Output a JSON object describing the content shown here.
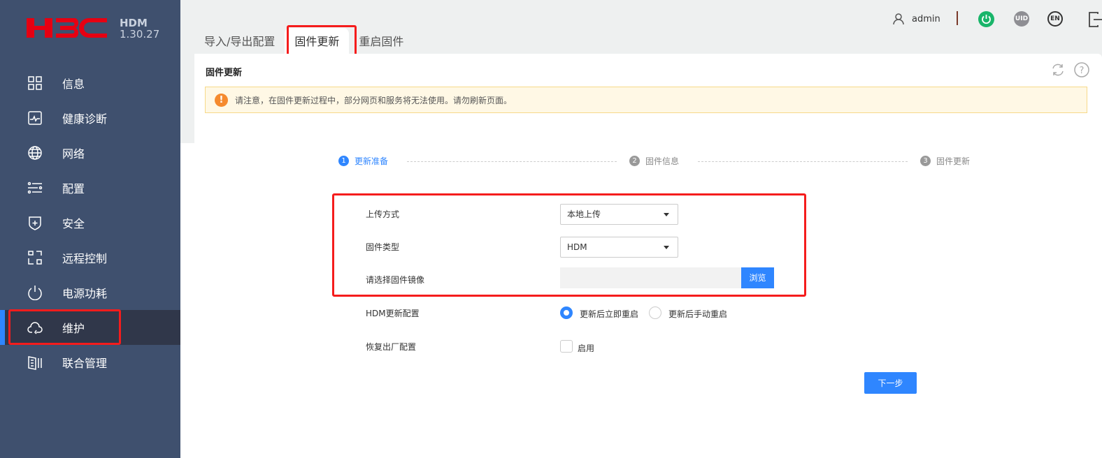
{
  "brand": {
    "logo_text": "H3C",
    "product": "HDM",
    "version": "1.30.27"
  },
  "sidebar": {
    "items": [
      {
        "label": "信息",
        "icon": "grid-icon"
      },
      {
        "label": "健康诊断",
        "icon": "health-monitor-icon"
      },
      {
        "label": "网络",
        "icon": "globe-icon"
      },
      {
        "label": "配置",
        "icon": "sliders-icon"
      },
      {
        "label": "安全",
        "icon": "shield-icon"
      },
      {
        "label": "远程控制",
        "icon": "remote-control-icon"
      },
      {
        "label": "电源功耗",
        "icon": "power-icon"
      },
      {
        "label": "维护",
        "icon": "cloud-icon",
        "active": true
      },
      {
        "label": "联合管理",
        "icon": "server-rack-icon"
      }
    ]
  },
  "header": {
    "user": "admin",
    "power_color": "#19b56a",
    "uid_label": "UID",
    "lang_label": "EN"
  },
  "tabs": [
    {
      "label": "导入/导出配置"
    },
    {
      "label": "固件更新",
      "active": true
    },
    {
      "label": "重启固件"
    }
  ],
  "card": {
    "title": "固件更新",
    "alert": "请注意，在固件更新过程中，部分网页和服务将无法使用。请勿刷新页面。"
  },
  "steps": [
    {
      "num": "1",
      "label": "更新准备"
    },
    {
      "num": "2",
      "label": "固件信息"
    },
    {
      "num": "3",
      "label": "固件更新"
    }
  ],
  "form": {
    "upload_method": {
      "label": "上传方式",
      "value": "本地上传"
    },
    "firmware_type": {
      "label": "固件类型",
      "value": "HDM"
    },
    "image": {
      "label": "请选择固件镜像",
      "value": "",
      "browse": "浏览"
    },
    "hdm_update": {
      "label": "HDM更新配置",
      "options": [
        "更新后立即重启",
        "更新后手动重启"
      ],
      "selected": 0
    },
    "factory_reset": {
      "label": "恢复出厂配置",
      "option": "启用",
      "checked": false
    },
    "next": "下一步"
  },
  "colors": {
    "accent": "#2f86ff",
    "sidebar": "#3f506e",
    "highlight": "#f51c1c"
  }
}
